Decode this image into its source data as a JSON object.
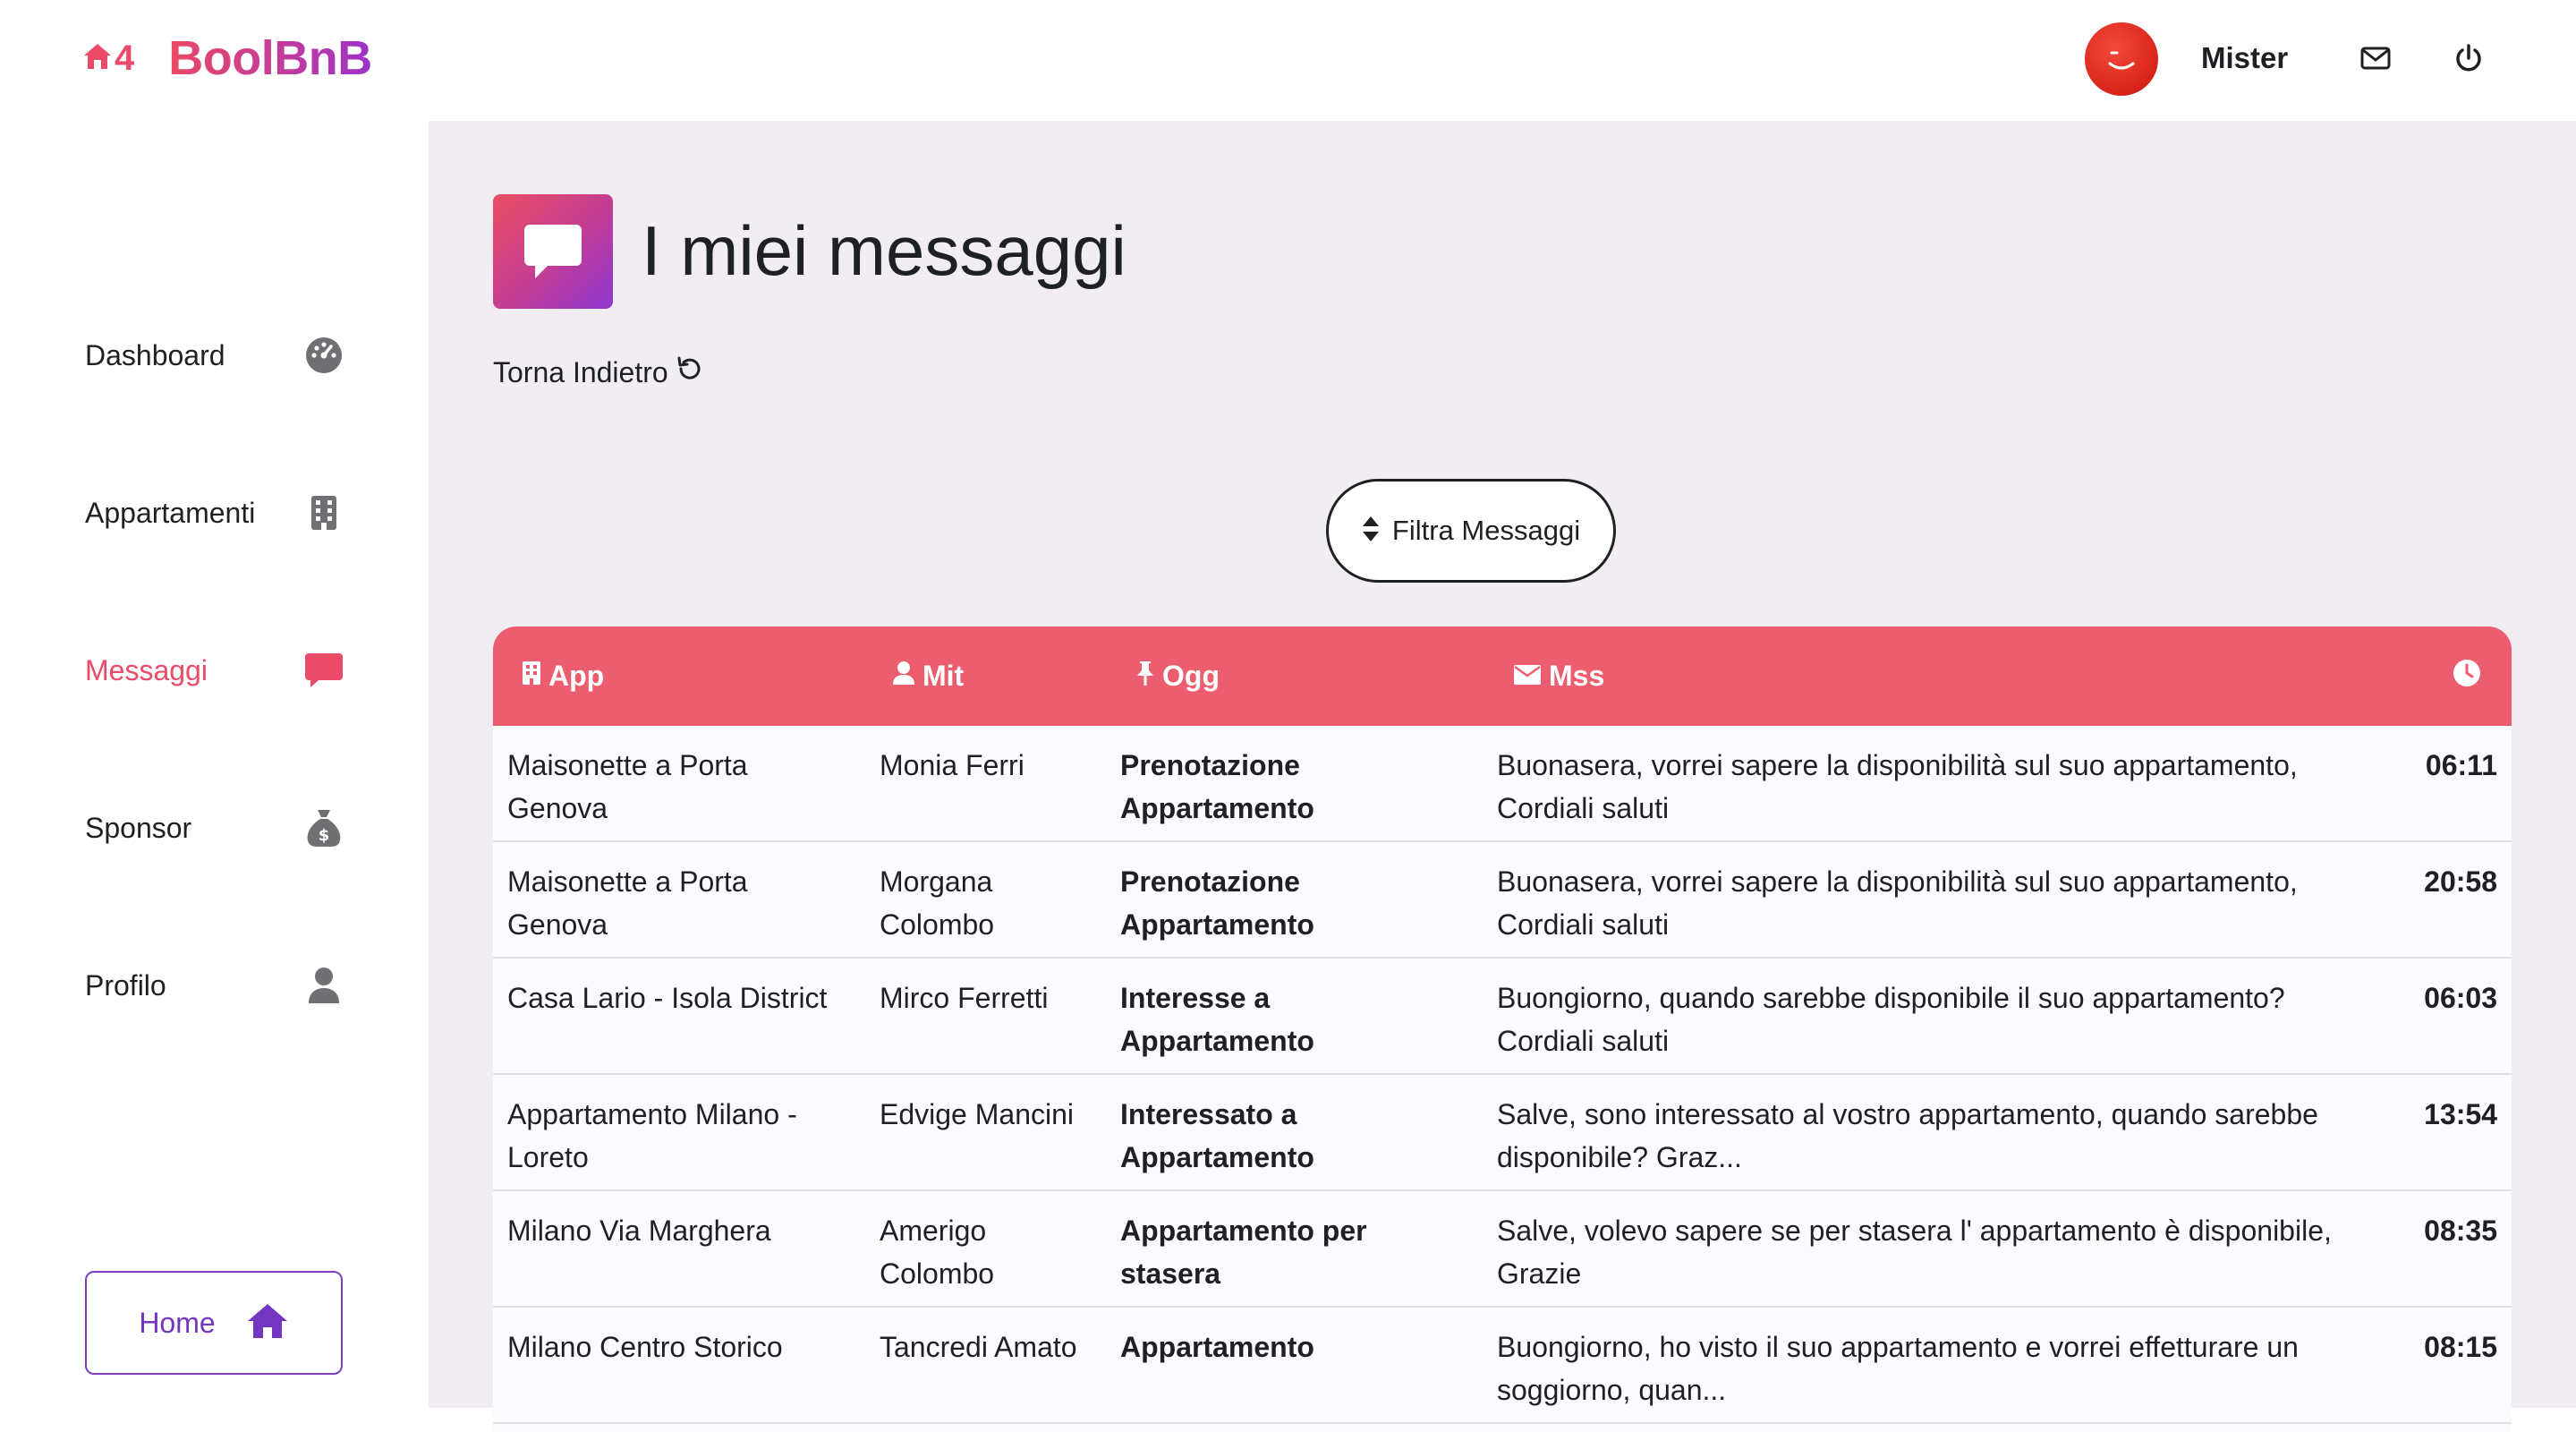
{
  "brand": {
    "logo_mark": "4",
    "name": "BoolBnB",
    "colors": {
      "accent": "#ec5d6f",
      "purple": "#7c3fc2"
    }
  },
  "topbar": {
    "user_name": "Mister",
    "icons": [
      "avatar",
      "envelope-icon",
      "power-icon"
    ]
  },
  "sidebar": {
    "items": [
      {
        "label": "Dashboard",
        "icon": "gauge-icon",
        "active": false
      },
      {
        "label": "Appartamenti",
        "icon": "building-icon",
        "active": false
      },
      {
        "label": "Messaggi",
        "icon": "chat-icon",
        "active": true
      },
      {
        "label": "Sponsor",
        "icon": "money-bag-icon",
        "active": false
      },
      {
        "label": "Profilo",
        "icon": "user-icon",
        "active": false
      }
    ],
    "home_button": {
      "label": "Home",
      "icon": "house-icon"
    }
  },
  "main": {
    "title": "I miei messaggi",
    "back_link": "Torna Indietro",
    "filter_button": "Filtra Messaggi",
    "table": {
      "headers": {
        "app": "App",
        "mit": "Mit",
        "ogg": "Ogg",
        "mss": "Mss",
        "time": ""
      },
      "rows": [
        {
          "app": "Maisonette a Porta Genova",
          "mit": "Monia Ferri",
          "ogg": "Prenotazione Appartamento",
          "mss": "Buonasera, vorrei sapere la disponibilità sul suo appartamento, Cordiali saluti",
          "time": "06:11"
        },
        {
          "app": "Maisonette a Porta Genova",
          "mit": "Morgana Colombo",
          "ogg": "Prenotazione Appartamento",
          "mss": "Buonasera, vorrei sapere la disponibilità sul suo appartamento, Cordiali saluti",
          "time": "20:58"
        },
        {
          "app": "Casa Lario - Isola District",
          "mit": "Mirco Ferretti",
          "ogg": "Interesse a Appartamento",
          "mss": "Buongiorno, quando sarebbe disponibile il suo appartamento? Cordiali saluti",
          "time": "06:03"
        },
        {
          "app": "Appartamento Milano - Loreto",
          "mit": "Edvige Mancini",
          "ogg": "Interessato a Appartamento",
          "mss": "Salve, sono interessato al vostro appartamento, quando sarebbe disponibile? Graz...",
          "time": "13:54"
        },
        {
          "app": "Milano Via Marghera",
          "mit": "Amerigo Colombo",
          "ogg": "Appartamento per stasera",
          "mss": "Salve, volevo sapere se per stasera l' appartamento è disponibile, Grazie",
          "time": "08:35"
        },
        {
          "app": "Milano Centro Storico",
          "mit": "Tancredi Amato",
          "ogg": "Appartamento",
          "mss": "Buongiorno, ho visto il suo appartamento e vorrei effetturare un soggiorno, quan...",
          "time": "08:15"
        }
      ]
    }
  }
}
